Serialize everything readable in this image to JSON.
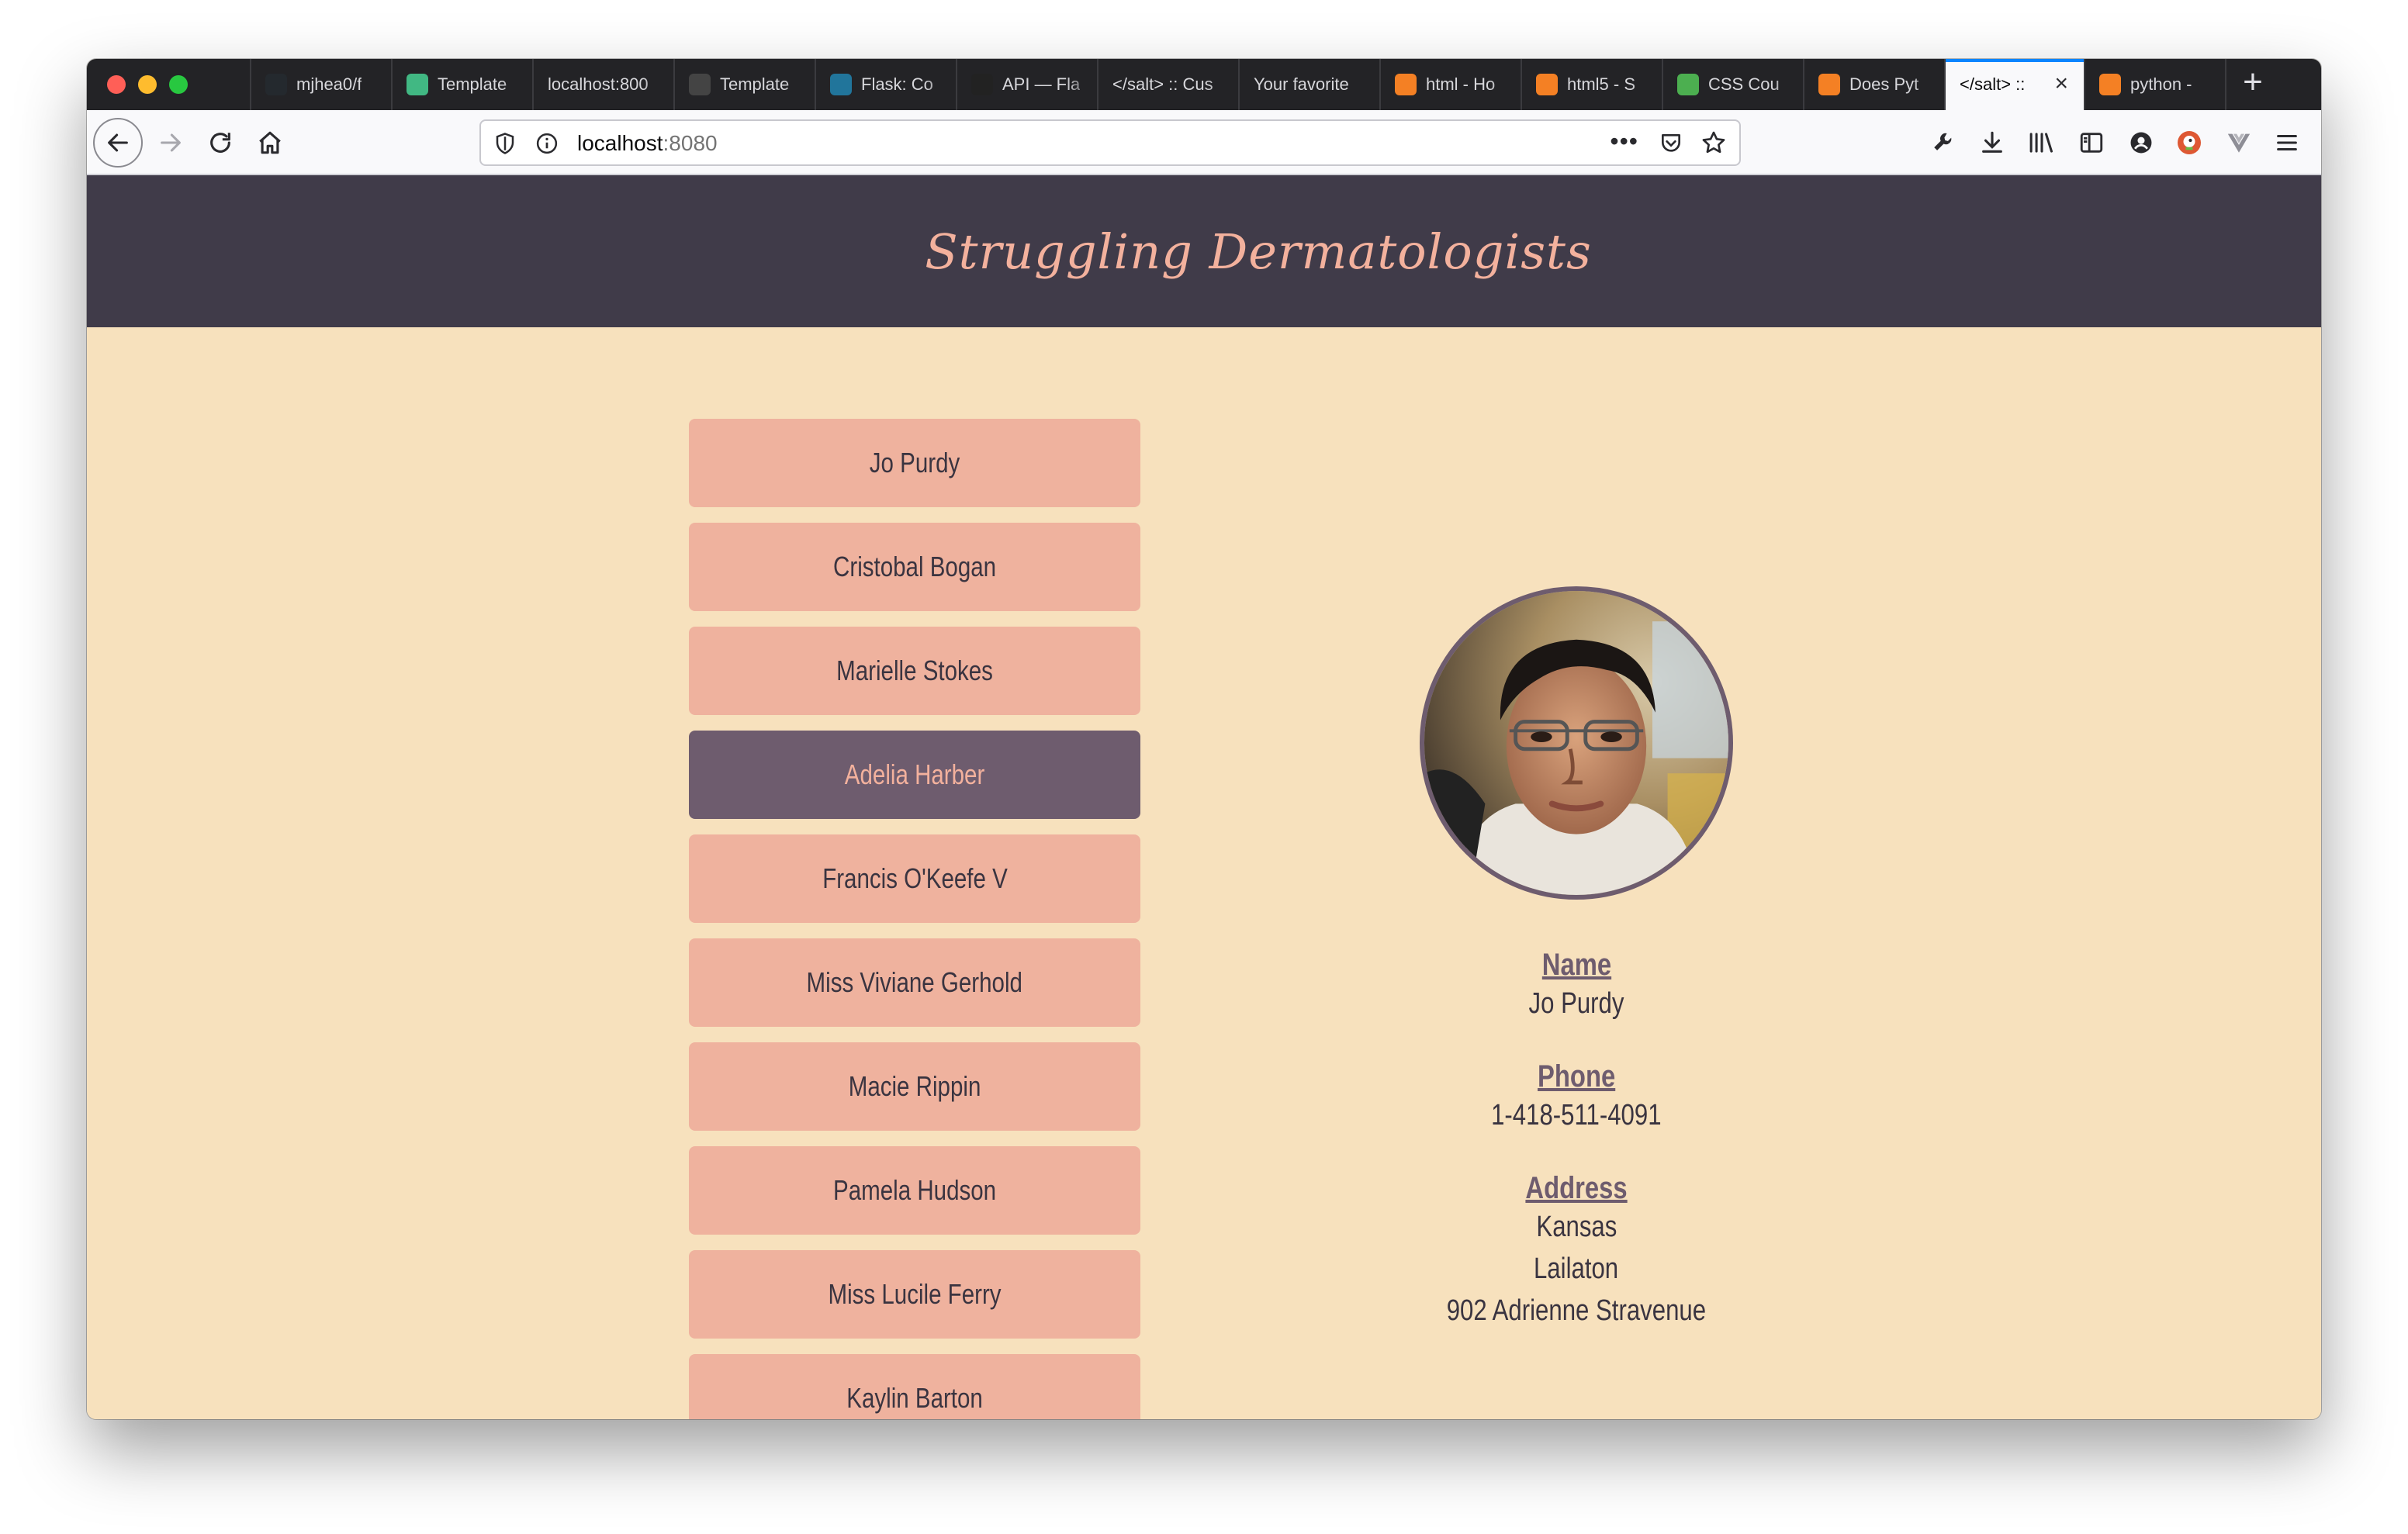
{
  "browser": {
    "tabs": [
      {
        "label": "mjhea0/f",
        "icon": "github-icon",
        "color": "#24292e"
      },
      {
        "label": "Template",
        "icon": "vue-icon",
        "color": "#41b883"
      },
      {
        "label": "localhost:800",
        "icon": "",
        "color": ""
      },
      {
        "label": "Template",
        "icon": "page-icon",
        "color": "#444"
      },
      {
        "label": "Flask: Co",
        "icon": "wordpress-icon",
        "color": "#21759b"
      },
      {
        "label": "API — Fla",
        "icon": "flask-icon",
        "color": "#222"
      },
      {
        "label": "</salt> :: Cus",
        "icon": "",
        "color": ""
      },
      {
        "label": "Your favorite",
        "icon": "",
        "color": ""
      },
      {
        "label": "html - Ho",
        "icon": "stackoverflow-icon",
        "color": "#f48024"
      },
      {
        "label": "html5 - S",
        "icon": "stackoverflow-icon",
        "color": "#f48024"
      },
      {
        "label": "CSS Cou",
        "icon": "w3schools-icon",
        "color": "#4caf50"
      },
      {
        "label": "Does Pyt",
        "icon": "stackoverflow-icon",
        "color": "#f48024"
      },
      {
        "label": "</salt> ::",
        "icon": "",
        "color": "",
        "active": true
      },
      {
        "label": "python -",
        "icon": "stackoverflow-icon",
        "color": "#f48024"
      }
    ],
    "url_host": "localhost",
    "url_port": ":8080"
  },
  "site": {
    "title": "Struggling Dermatologists"
  },
  "people": [
    {
      "name": "Jo Purdy",
      "active": false
    },
    {
      "name": "Cristobal Bogan",
      "active": false
    },
    {
      "name": "Marielle Stokes",
      "active": false
    },
    {
      "name": "Adelia Harber",
      "active": true
    },
    {
      "name": "Francis O'Keefe V",
      "active": false
    },
    {
      "name": "Miss Viviane Gerhold",
      "active": false
    },
    {
      "name": "Macie Rippin",
      "active": false
    },
    {
      "name": "Pamela Hudson",
      "active": false
    },
    {
      "name": "Miss Lucile Ferry",
      "active": false
    },
    {
      "name": "Kaylin Barton",
      "active": false
    }
  ],
  "profile": {
    "name_label": "Name",
    "name_value": "Jo Purdy",
    "phone_label": "Phone",
    "phone_value": "1-418-511-4091",
    "address_label": "Address",
    "address_lines": [
      "Kansas",
      "Lailaton",
      "902 Adrienne Stravenue"
    ]
  },
  "colors": {
    "header_bg": "#403b49",
    "page_bg": "#f7e1bd",
    "button_bg": "#efb29e",
    "button_active_bg": "#6e5c6e",
    "accent_text": "#f3b19d"
  }
}
